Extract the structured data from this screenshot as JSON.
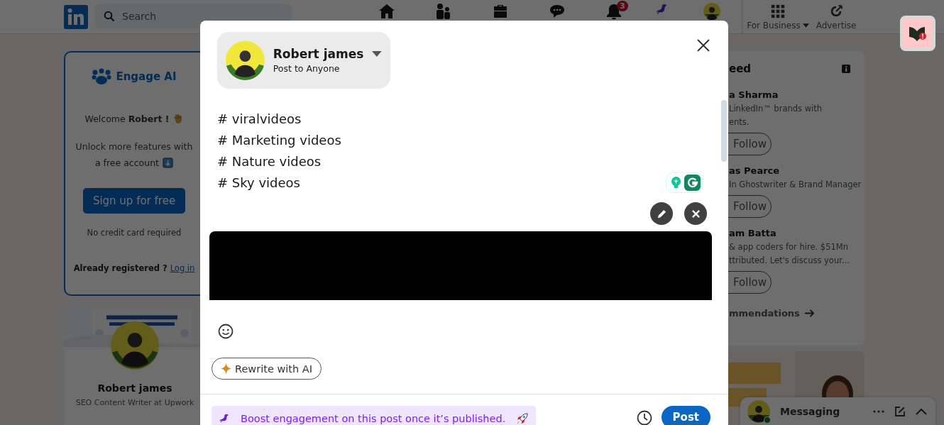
{
  "nav": {
    "search_placeholder": "Search",
    "notifications_badge": "3",
    "business_label": "For Business",
    "advertise_label": "Advertise"
  },
  "engage_card": {
    "brand": "Engage AI",
    "welcome": "Welcome **Robert !**",
    "unlock_lines": [
      "Unlock more features with",
      "a free account"
    ],
    "signup_button": "Sign up for free",
    "note": "No credit card required",
    "registered": "Already registered ?",
    "login_link": "Log in"
  },
  "profile_card": {
    "name": "Robert james",
    "headline": "SEO Content Writer at Upwork"
  },
  "feed_card": {
    "title": "eed",
    "suggestions": [
      {
        "name": "a Sharma",
        "lines": [
          "LinkedIn™ brands with",
          "ents."
        ],
        "button": "Follow"
      },
      {
        "name": "as Pearce",
        "lines": [
          "In Ghostwriter & Brand Manager"
        ],
        "button": "Follow"
      },
      {
        "name": "am Batta",
        "lines": [
          "& app coders for hire. $51Mn",
          "ttributed. Let's discuss your..."
        ],
        "button": "Follow"
      }
    ],
    "footer_link": "mmendations"
  },
  "messaging": {
    "label": "Messaging",
    "online": true
  },
  "composer": {
    "author": "Robert james",
    "audience": "Post to Anyone",
    "post_lines": [
      "# viralvideos",
      "# Marketing videos",
      "# Nature videos",
      "# Sky videos"
    ],
    "rewrite_button": "Rewrite with AI",
    "boost_text": "Boost engagement on this post once it’s published.",
    "post_button": "Post"
  }
}
